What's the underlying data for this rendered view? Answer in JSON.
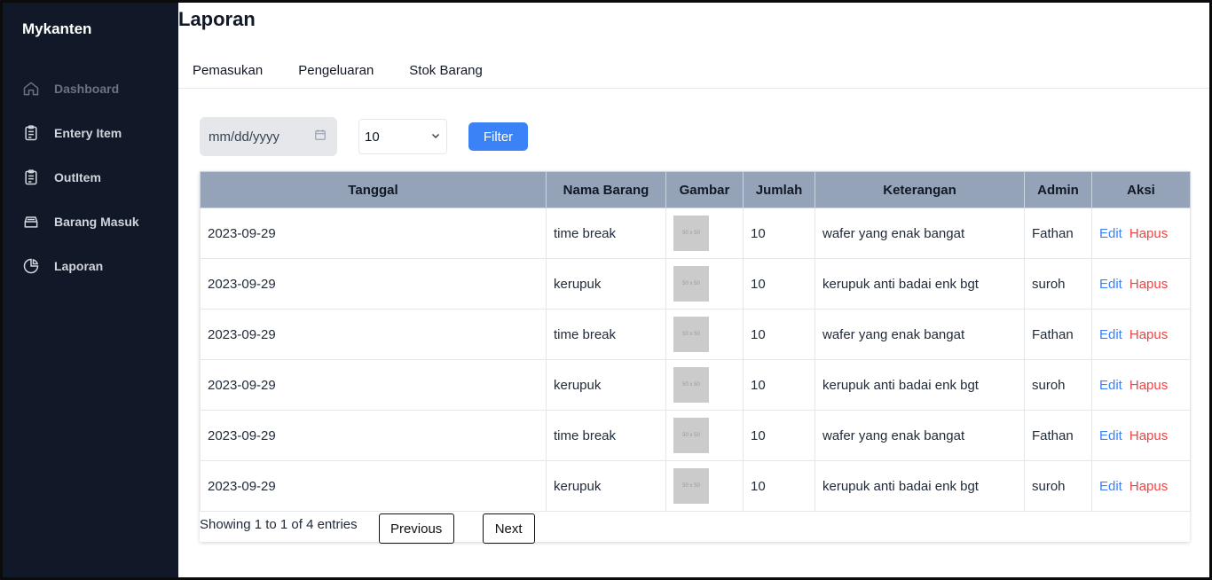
{
  "app": {
    "brand": "Mykanten"
  },
  "sidebar": {
    "items": [
      {
        "label": "Dashboard",
        "icon": "home-icon"
      },
      {
        "label": "Entery Item",
        "icon": "clipboard-icon"
      },
      {
        "label": "OutItem",
        "icon": "clipboard-icon"
      },
      {
        "label": "Barang Masuk",
        "icon": "inbox-icon"
      },
      {
        "label": "Laporan",
        "icon": "pie-chart-icon"
      }
    ]
  },
  "page": {
    "title": "Laporan"
  },
  "tabs": [
    "Pemasukan",
    "Pengeluaran",
    "Stok Barang"
  ],
  "filters": {
    "date_placeholder": "mm/dd/yyyy",
    "page_size": "10",
    "filter_label": "Filter"
  },
  "table": {
    "headers": [
      "Tanggal",
      "Nama Barang",
      "Gambar",
      "Jumlah",
      "Keterangan",
      "Admin",
      "Aksi"
    ],
    "thumb_text": "50 x 50",
    "rows": [
      {
        "tanggal": "2023-09-29",
        "nama": "time break",
        "jumlah": "10",
        "keterangan": "wafer yang enak bangat",
        "admin": "Fathan",
        "edit": "Edit",
        "hapus": "Hapus"
      },
      {
        "tanggal": "2023-09-29",
        "nama": "kerupuk",
        "jumlah": "10",
        "keterangan": "kerupuk anti badai enk bgt",
        "admin": "suroh",
        "edit": "Edit",
        "hapus": "Hapus"
      },
      {
        "tanggal": "2023-09-29",
        "nama": "time break",
        "jumlah": "10",
        "keterangan": "wafer yang enak bangat",
        "admin": "Fathan",
        "edit": "Edit",
        "hapus": "Hapus"
      },
      {
        "tanggal": "2023-09-29",
        "nama": "kerupuk",
        "jumlah": "10",
        "keterangan": "kerupuk anti badai enk bgt",
        "admin": "suroh",
        "edit": "Edit",
        "hapus": "Hapus"
      },
      {
        "tanggal": "2023-09-29",
        "nama": "time break",
        "jumlah": "10",
        "keterangan": "wafer yang enak bangat",
        "admin": "Fathan",
        "edit": "Edit",
        "hapus": "Hapus"
      },
      {
        "tanggal": "2023-09-29",
        "nama": "kerupuk",
        "jumlah": "10",
        "keterangan": "kerupuk anti badai enk bgt",
        "admin": "suroh",
        "edit": "Edit",
        "hapus": "Hapus"
      }
    ]
  },
  "pagination": {
    "showing": "Showing 1 to 1 of 4 entries",
    "previous": "Previous",
    "next": "Next"
  },
  "colors": {
    "sidebar_bg": "#111827",
    "header_bg": "#94a3b8",
    "accent": "#3b82f6",
    "danger": "#ef4444"
  }
}
